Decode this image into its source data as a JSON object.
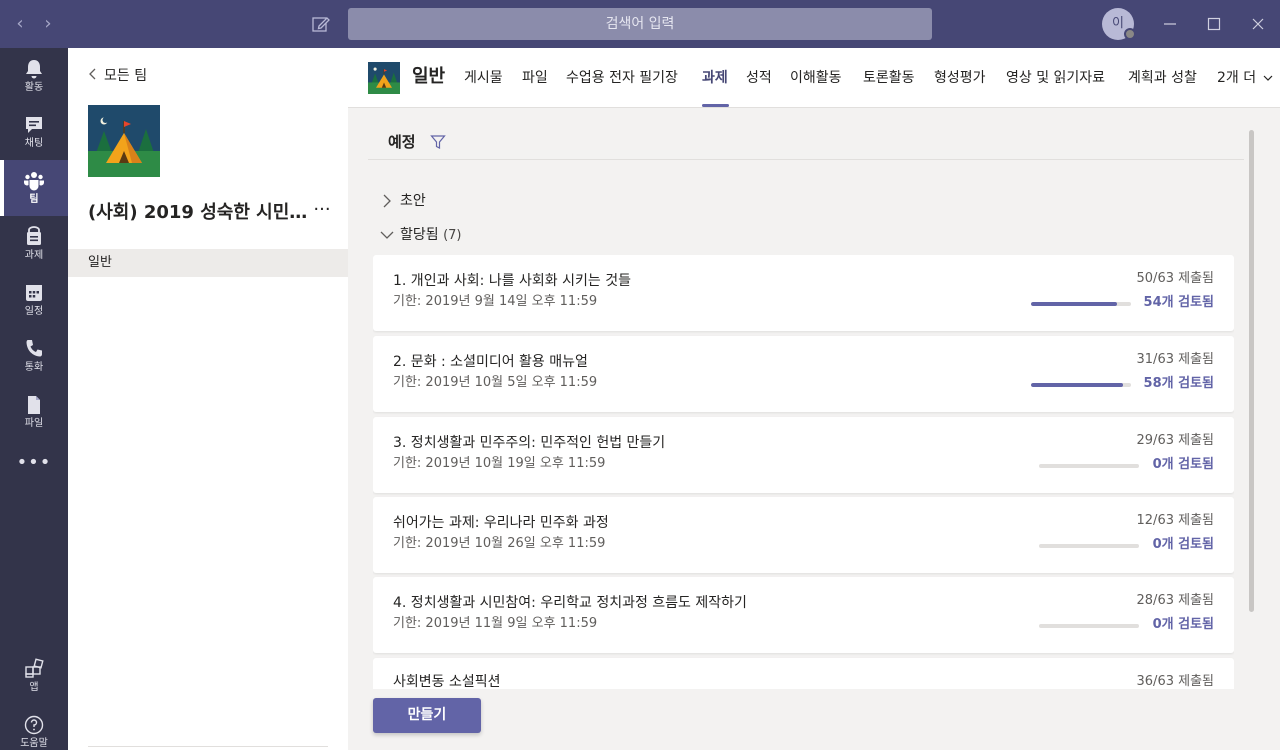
{
  "titlebar": {
    "search_placeholder": "검색어 입력",
    "avatar_initial": "이"
  },
  "rail": {
    "items": [
      {
        "label": "활동",
        "icon": "bell-icon"
      },
      {
        "label": "채팅",
        "icon": "chat-icon"
      },
      {
        "label": "팀",
        "icon": "teams-icon"
      },
      {
        "label": "과제",
        "icon": "assignments-icon"
      },
      {
        "label": "일정",
        "icon": "calendar-icon"
      },
      {
        "label": "통화",
        "icon": "phone-icon"
      },
      {
        "label": "파일",
        "icon": "file-icon"
      }
    ],
    "more": "•••",
    "apps_label": "앱",
    "help_label": "도움말",
    "active_index": 2
  },
  "sidepanel": {
    "back_label": "모든 팀",
    "team_name": "(사회) 2019 성숙한 시민...",
    "more": "···",
    "channel": "일반"
  },
  "header": {
    "channel_name": "일반",
    "tabs": [
      "게시물",
      "파일",
      "수업용 전자 필기장",
      "과제",
      "성적",
      "이해활동",
      "토론활동",
      "형성평가",
      "영상 및 읽기자료",
      "계획과 성찰",
      "2개 더"
    ],
    "active_tab": "과제"
  },
  "content": {
    "filter_title": "예정",
    "sections": {
      "draft": "초안",
      "assigned": "할당됨",
      "assigned_count": "(7)"
    },
    "assignments": [
      {
        "title": "1. 개인과 사회: 나를 사회화 시키는 것들",
        "due": "기한: 2019년 9월 14일 오후 11:59",
        "submitted": "50/63 제출됨",
        "reviewed": "54개 검토됨",
        "progress": 0.86
      },
      {
        "title": "2. 문화 : 소셜미디어 활용 매뉴얼",
        "due": "기한: 2019년 10월 5일 오후 11:59",
        "submitted": "31/63 제출됨",
        "reviewed": "58개 검토됨",
        "progress": 0.92
      },
      {
        "title": "3. 정치생활과 민주주의: 민주적인 헌법 만들기",
        "due": "기한: 2019년 10월 19일 오후 11:59",
        "submitted": "29/63 제출됨",
        "reviewed": "0개 검토됨",
        "progress": 0
      },
      {
        "title": "쉬어가는 과제: 우리나라 민주화 과정",
        "due": "기한: 2019년 10월 26일 오후 11:59",
        "submitted": "12/63 제출됨",
        "reviewed": "0개 검토됨",
        "progress": 0
      },
      {
        "title": "4. 정치생활과 시민참여: 우리학교 정치과정 흐름도 제작하기",
        "due": "기한: 2019년 11월 9일 오후 11:59",
        "submitted": "28/63 제출됨",
        "reviewed": "0개 검토됨",
        "progress": 0
      },
      {
        "title": "사회변동 소설픽션",
        "due": "",
        "submitted": "36/63 제출됨",
        "reviewed": "",
        "progress": 0
      }
    ],
    "create_button": "만들기"
  }
}
